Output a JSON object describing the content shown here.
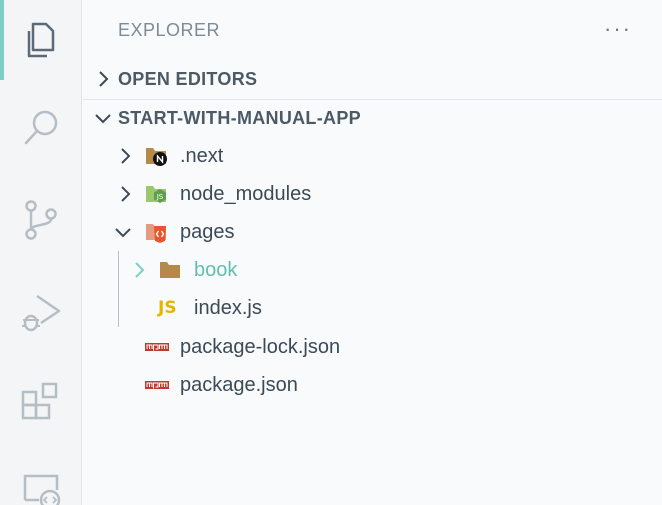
{
  "activity_bar": {
    "items": [
      {
        "icon": "explorer-icon",
        "active": true
      },
      {
        "icon": "search-icon",
        "active": false
      },
      {
        "icon": "source-control-icon",
        "active": false
      },
      {
        "icon": "run-debug-icon",
        "active": false
      },
      {
        "icon": "extensions-icon",
        "active": false
      },
      {
        "icon": "remote-explorer-icon",
        "active": false
      }
    ]
  },
  "explorer": {
    "title": "EXPLORER",
    "more_actions": "···",
    "open_editors_label": "OPEN EDITORS",
    "project_label": "START-WITH-MANUAL-APP",
    "tree": [
      {
        "name": ".next",
        "type": "folder",
        "expanded": false,
        "icon": "nextjs-folder-icon"
      },
      {
        "name": "node_modules",
        "type": "folder",
        "expanded": false,
        "icon": "node-folder-icon"
      },
      {
        "name": "pages",
        "type": "folder",
        "expanded": true,
        "icon": "pages-folder-icon"
      },
      {
        "name": "book",
        "type": "folder",
        "expanded": false,
        "icon": "folder-icon",
        "highlighted": true
      },
      {
        "name": "index.js",
        "type": "file",
        "icon": "javascript-file-icon",
        "icon_text": "JS"
      },
      {
        "name": "package-lock.json",
        "type": "file",
        "icon": "npm-file-icon"
      },
      {
        "name": "package.json",
        "type": "file",
        "icon": "npm-file-icon"
      }
    ]
  },
  "colors": {
    "accent": "#7dcfc4",
    "highlight_text": "#5fbfb0",
    "folder": "#b5894a",
    "js": "#e8b400",
    "npm": "#c0392b",
    "node": "#8cc84b",
    "pages": "#e8552a"
  }
}
